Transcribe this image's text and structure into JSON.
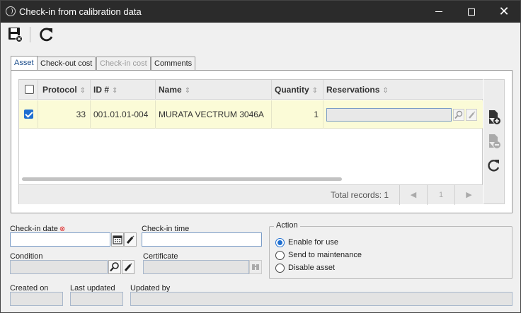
{
  "window": {
    "title": "Check-in from calibration data"
  },
  "tabs": [
    {
      "label": "Asset",
      "state": "active"
    },
    {
      "label": "Check-out cost",
      "state": "normal"
    },
    {
      "label": "Check-in cost",
      "state": "disabled"
    },
    {
      "label": "Comments",
      "state": "normal"
    }
  ],
  "grid": {
    "columns": [
      "Protocol",
      "ID #",
      "Name",
      "Quantity",
      "Reservations"
    ],
    "rows": [
      {
        "checked": true,
        "protocol": "33",
        "id": "001.01.01-004",
        "name": "MURATA VECTRUM 3046A",
        "quantity": "1",
        "reservations": ""
      }
    ],
    "footer": {
      "total_records": "Total records: 1",
      "page": "1"
    }
  },
  "form": {
    "checkin_date_label": "Check-in date",
    "checkin_time_label": "Check-in time",
    "condition_label": "Condition",
    "certificate_label": "Certificate",
    "created_on_label": "Created on",
    "last_updated_label": "Last updated",
    "updated_by_label": "Updated by",
    "checkin_date": "",
    "checkin_time": "",
    "condition": "",
    "certificate": "",
    "created_on": "",
    "last_updated": "",
    "updated_by": ""
  },
  "action": {
    "title": "Action",
    "options": [
      {
        "label": "Enable for use",
        "selected": true
      },
      {
        "label": "Send to maintenance",
        "selected": false
      },
      {
        "label": "Disable asset",
        "selected": false
      }
    ]
  },
  "colors": {
    "selected_row": "#fbfbd7",
    "accent": "#1f6fd1",
    "titlebar": "#2b2b2b"
  }
}
